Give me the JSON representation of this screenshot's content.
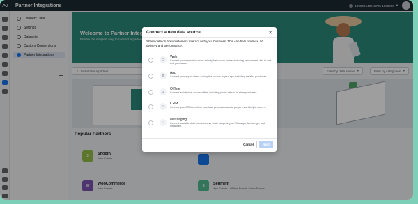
{
  "app": {
    "title": "Partner Integrations",
    "account_id": "100000640215785 1000000"
  },
  "sidebar": {
    "items": [
      {
        "label": "Connect Data"
      },
      {
        "label": "Settings"
      },
      {
        "label": "Datasets"
      },
      {
        "label": "Custom Conversions"
      },
      {
        "label": "Partner Integrations"
      }
    ]
  },
  "hero": {
    "title": "Welcome to Partner Integrations",
    "subtitle": "Enable the simplest way to connect a partner, without coding."
  },
  "filters": {
    "search_placeholder": "Search for a partner",
    "data_source": "Filter by data source",
    "categories": "Filter by categories"
  },
  "popular": {
    "title": "Popular Partners",
    "partners": [
      {
        "name": "Shopify",
        "type": "Web Events",
        "icon": "shopify-icon",
        "color": "#95bf47"
      },
      {
        "name": "WooCommerce",
        "type": "Web Events",
        "icon": "woocommerce-icon",
        "color": "#7f54b3"
      },
      {
        "name": "Segment",
        "type": "App Events · Offline Events · Web Events",
        "icon": "segment-icon",
        "color": "#52bd94"
      }
    ]
  },
  "modal": {
    "title": "Connect a new data source",
    "close_icon": "close-icon",
    "description": "Share data on how customers interact with your business. This can help optimise ad delivery and performance.",
    "options": [
      {
        "name": "Web",
        "icon": "monitor-icon",
        "description": "Connect your website to share activity that occurs online, including new content, add to cart and purchases."
      },
      {
        "name": "App",
        "icon": "phone-icon",
        "description": "Connect your app to share activity that occurs in your app, including installs, purchases."
      },
      {
        "name": "Offline",
        "icon": "store-icon",
        "description": "Connect activity that occurs offline, including phone calls or in-store purchases."
      },
      {
        "name": "CRM",
        "icon": "people-icon",
        "description": "Connect your CRM to deliver your lead generation ads to people most likely to convert."
      },
      {
        "name": "Messaging",
        "icon": "chat-icon",
        "description": "Connect valuable data from business chats happening on WhatsApp, Messenger and Instagram."
      }
    ],
    "cancel_label": "Cancel",
    "next_label": "Next"
  },
  "colors": {
    "accent": "#1877f2",
    "hero": "#2c8c7c",
    "topbar": "#1c2b33"
  }
}
